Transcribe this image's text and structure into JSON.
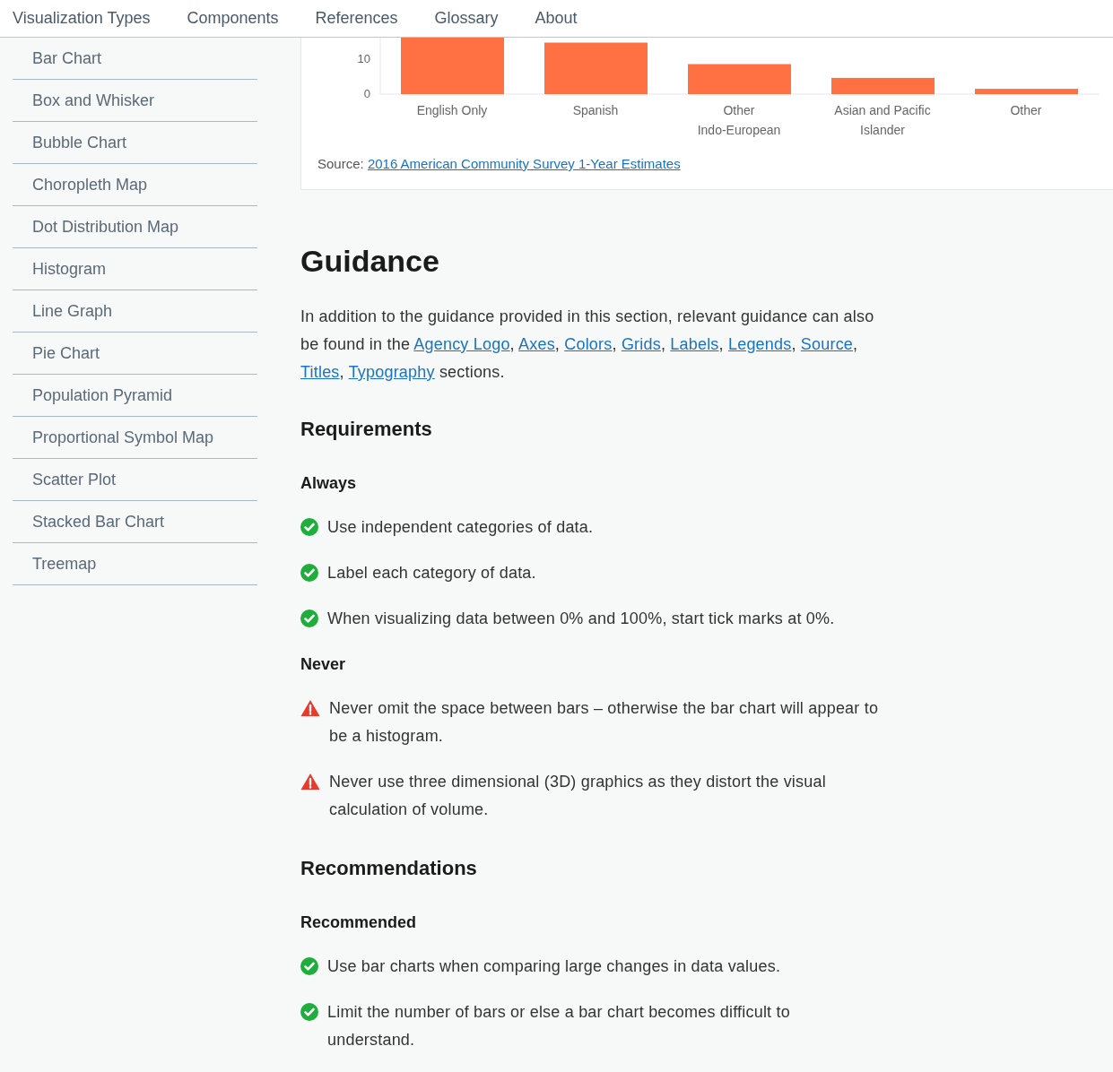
{
  "nav": [
    {
      "label": "Visualization Types"
    },
    {
      "label": "Components"
    },
    {
      "label": "References"
    },
    {
      "label": "Glossary"
    },
    {
      "label": "About"
    }
  ],
  "sidebar": {
    "items": [
      {
        "label": "Bar Chart"
      },
      {
        "label": "Box and Whisker"
      },
      {
        "label": "Bubble Chart"
      },
      {
        "label": "Choropleth Map"
      },
      {
        "label": "Dot Distribution Map"
      },
      {
        "label": "Histogram"
      },
      {
        "label": "Line Graph"
      },
      {
        "label": "Pie Chart"
      },
      {
        "label": "Population Pyramid"
      },
      {
        "label": "Proportional Symbol Map"
      },
      {
        "label": "Scatter Plot"
      },
      {
        "label": "Stacked Bar Chart"
      },
      {
        "label": "Treemap"
      }
    ]
  },
  "chart_card": {
    "chart_data": {
      "type": "bar",
      "categories": [
        "English Only",
        "Spanish",
        "Other\nIndo-European",
        "Asian and Pacific\nIslander",
        "Other"
      ],
      "series": [
        {
          "color": "#ff7043",
          "values": [
            16,
            14.6,
            8.5,
            4.6,
            1.5
          ]
        }
      ],
      "ylim": [
        0,
        16
      ],
      "yticks": [
        0,
        10
      ]
    },
    "source_label": "Source:",
    "source_link": "2016 American Community Survey 1-Year Estimates"
  },
  "guidance": {
    "title": "Guidance",
    "intro": [
      {
        "kind": "text",
        "text": "In addition to the guidance provided in this section, relevant guidance can also be found in the "
      },
      {
        "kind": "link",
        "text": "Agency Logo"
      },
      {
        "kind": "text",
        "text": ", "
      },
      {
        "kind": "link",
        "text": "Axes"
      },
      {
        "kind": "text",
        "text": ", "
      },
      {
        "kind": "link",
        "text": "Colors"
      },
      {
        "kind": "text",
        "text": ", "
      },
      {
        "kind": "link",
        "text": "Grids"
      },
      {
        "kind": "text",
        "text": ", "
      },
      {
        "kind": "link",
        "text": "Labels"
      },
      {
        "kind": "text",
        "text": ", "
      },
      {
        "kind": "link",
        "text": "Legends"
      },
      {
        "kind": "text",
        "text": ", "
      },
      {
        "kind": "link",
        "text": "Source"
      },
      {
        "kind": "text",
        "text": ", "
      },
      {
        "kind": "link",
        "text": "Titles"
      },
      {
        "kind": "text",
        "text": ", "
      },
      {
        "kind": "link",
        "text": "Typography"
      },
      {
        "kind": "text",
        "text": " sections."
      }
    ],
    "sections": [
      {
        "title": "Requirements",
        "groups": [
          {
            "title": "Always",
            "items": [
              {
                "kind": "do",
                "text": "Use independent categories of data."
              },
              {
                "kind": "do",
                "text": "Label each category of data."
              },
              {
                "kind": "do",
                "text": "When visualizing data between 0% and 100%, start tick marks at 0%."
              }
            ]
          },
          {
            "title": "Never",
            "items": [
              {
                "kind": "dont",
                "text": "Never omit the space between bars – otherwise the bar chart will appear to be a histogram."
              },
              {
                "kind": "dont",
                "text": "Never use three dimensional (3D) graphics as they distort the visual calculation of volume."
              }
            ]
          }
        ]
      },
      {
        "title": "Recommendations",
        "groups": [
          {
            "title": "Recommended",
            "items": [
              {
                "kind": "do",
                "text": "Use bar charts when comparing large changes in data values."
              },
              {
                "kind": "do",
                "text": "Limit the number of bars or else a bar chart becomes difficult to understand."
              }
            ]
          }
        ]
      }
    ]
  }
}
